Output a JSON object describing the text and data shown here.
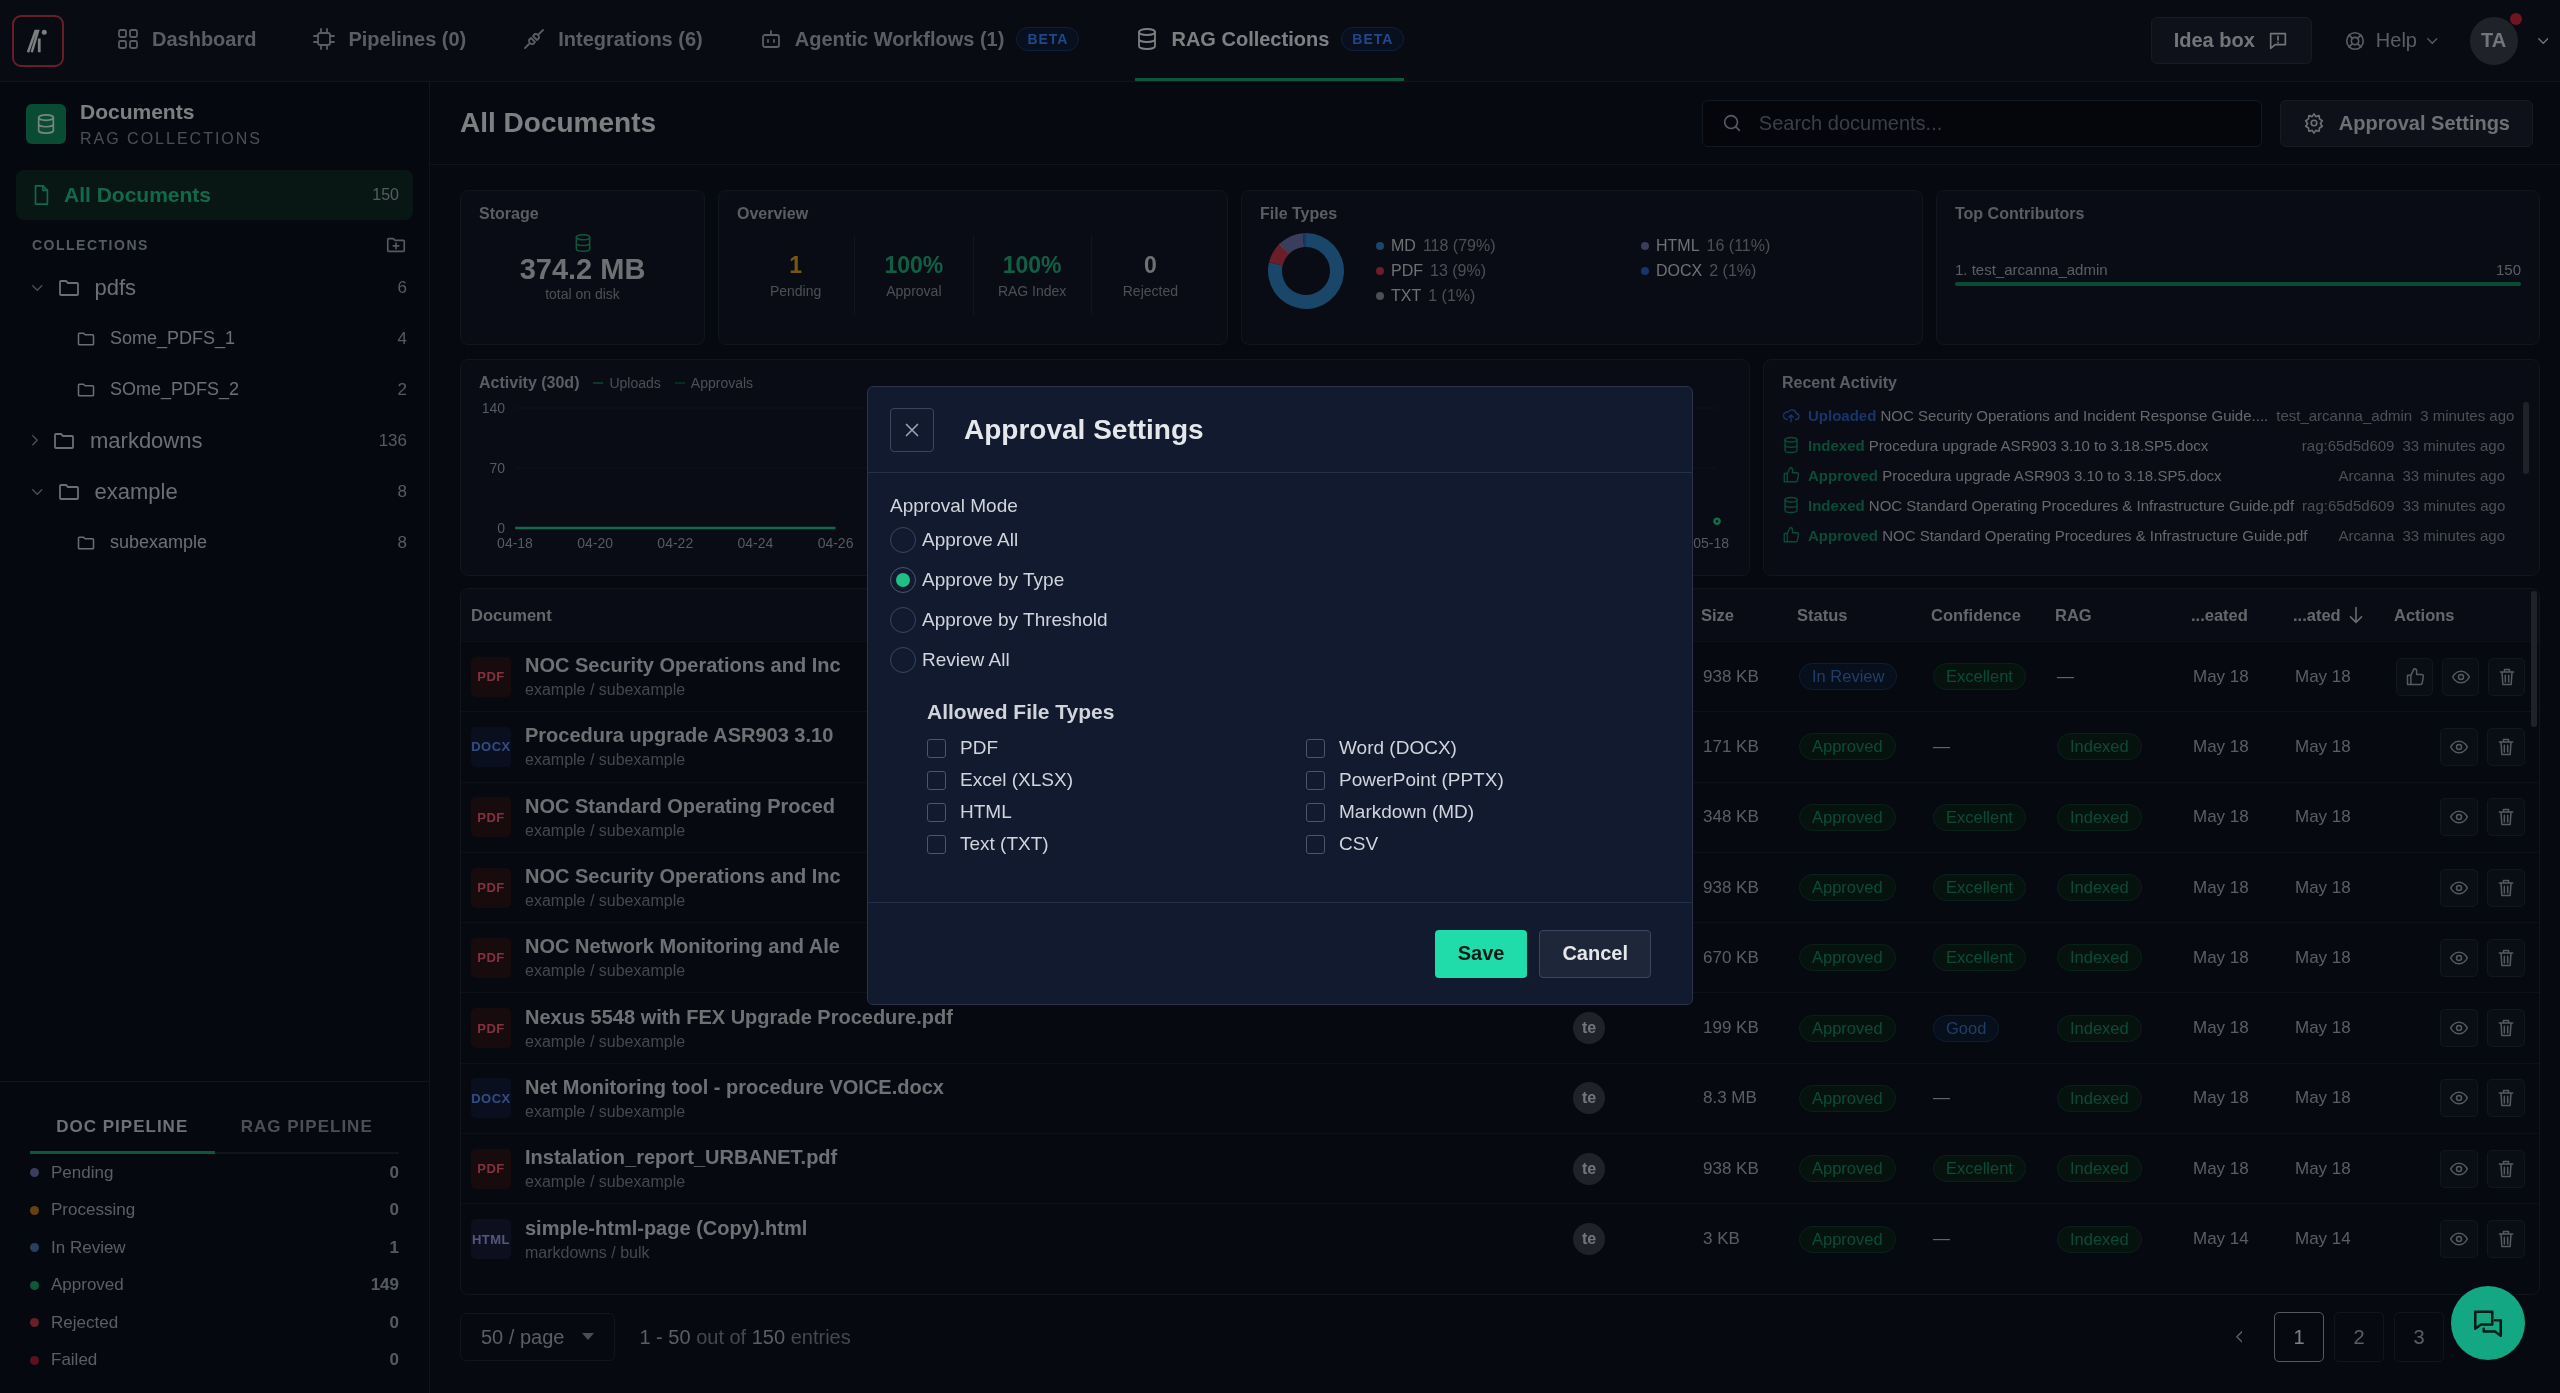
{
  "nav": {
    "tabs": [
      {
        "label": "Dashboard",
        "selected": false
      },
      {
        "label": "Pipelines (0)",
        "selected": false
      },
      {
        "label": "Integrations (6)",
        "selected": false
      },
      {
        "label": "Agentic Workflows (1)",
        "badge": "BETA",
        "selected": false
      },
      {
        "label": "RAG Collections",
        "badge": "BETA",
        "selected": true
      }
    ],
    "idea_box": "Idea box",
    "help": "Help",
    "avatar": "TA",
    "notification": true
  },
  "sidebar": {
    "title": "Documents",
    "subtitle": "RAG COLLECTIONS",
    "all_documents": {
      "label": "All Documents",
      "count": "150",
      "selected": true
    },
    "collections_label": "COLLECTIONS",
    "tree": [
      {
        "label": "pdfs",
        "count": "6",
        "expanded": true,
        "children": [
          {
            "label": "Some_PDFS_1",
            "count": "4"
          },
          {
            "label": "SOme_PDFS_2",
            "count": "2"
          }
        ]
      },
      {
        "label": "markdowns",
        "count": "136",
        "expanded": false
      },
      {
        "label": "example",
        "count": "8",
        "expanded": true,
        "children": [
          {
            "label": "subexample",
            "count": "8"
          }
        ]
      }
    ],
    "pipeline_tabs": [
      {
        "label": "DOC PIPELINE",
        "selected": true
      },
      {
        "label": "RAG PIPELINE",
        "selected": false
      }
    ],
    "pipeline_statuses": [
      {
        "label": "Pending",
        "count": "0",
        "color": "#3b3d5c"
      },
      {
        "label": "Processing",
        "count": "0",
        "color": "#654311"
      },
      {
        "label": "In Review",
        "count": "1",
        "color": "#293f61"
      },
      {
        "label": "Approved",
        "count": "149",
        "color": "#0c5a3a"
      },
      {
        "label": "Rejected",
        "count": "0",
        "color": "#6a1e29"
      },
      {
        "label": "Failed",
        "count": "0",
        "color": "#5a1220"
      }
    ]
  },
  "header": {
    "title": "All Documents",
    "search": {
      "placeholder": "Search documents..."
    },
    "settings_button": "Approval Settings"
  },
  "storage": {
    "title": "Storage",
    "value": "374.2 MB",
    "caption": "total on disk"
  },
  "overview": {
    "title": "Overview",
    "stats": [
      {
        "value": "1",
        "label": "Pending",
        "kind": "warning"
      },
      {
        "value": "100%",
        "label": "Approval",
        "kind": "success"
      },
      {
        "value": "100%",
        "label": "RAG Index",
        "kind": "success"
      },
      {
        "value": "0",
        "label": "Rejected",
        "kind": "neutral"
      }
    ]
  },
  "file_types": {
    "title": "File Types",
    "legend": [
      {
        "detail": "118 (79%)",
        "color": "#1a466a"
      },
      {
        "detail": "13 (9%)",
        "color": "#6a1e29"
      },
      {
        "detail": "1 (1%)",
        "color": "#4c4f54"
      },
      {
        "detail": "16 (11%)",
        "color": "#3b3d5c"
      },
      {
        "detail": "2 (1%)",
        "color": "#1a346a"
      }
    ],
    "chart_data": {
      "type": "donut",
      "categories": [
        "MD",
        "PDF",
        "TXT",
        "HTML",
        "DOCX"
      ],
      "values": [
        78.67,
        8.67,
        0.67,
        10.67,
        1.32
      ]
    }
  },
  "top_contributors": {
    "title": "Top Contributors",
    "items": [
      {
        "name": "1. test_arcanna_admin",
        "count": "150",
        "level": 1
      }
    ]
  },
  "activity": {
    "title": "Activity (30d)",
    "chart_data": {
      "type": "line",
      "ylim": [
        0,
        140
      ],
      "yticks": [
        0,
        70,
        140
      ],
      "categories": [
        "04-18",
        null,
        "04-20",
        null,
        "04-22",
        null,
        "04-24",
        null,
        "04-26",
        null,
        null,
        null,
        null,
        null,
        null,
        null,
        null,
        null,
        null,
        null,
        null,
        null,
        null,
        null,
        null,
        null,
        null,
        null,
        null,
        null,
        "05-18"
      ],
      "series": [
        {
          "name": "Uploads",
          "color": "#0f6a47",
          "values": [
            0,
            0,
            0,
            0,
            0,
            0,
            0,
            0,
            0,
            null,
            null,
            null,
            null,
            null,
            null,
            null,
            null,
            null,
            null,
            null,
            null,
            null,
            null,
            null,
            null,
            null,
            null,
            null,
            null,
            null,
            8
          ]
        },
        {
          "name": "Approvals",
          "color": "#0b5238",
          "values": [
            null,
            null,
            null,
            null,
            null,
            null,
            null,
            null,
            null,
            null,
            null,
            null,
            null,
            null,
            null,
            null,
            null,
            null,
            null,
            null,
            null,
            null,
            null,
            null,
            null,
            null,
            null,
            null,
            null,
            null,
            null
          ]
        }
      ]
    }
  },
  "recent_activity": {
    "title": "Recent Activity",
    "items": [
      {
        "kind": "uploaded",
        "action": "Uploaded",
        "file": "NOC Security Operations and Incident Response Guide....",
        "actor": "test_arcanna_admin",
        "time": "3 minutes ago"
      },
      {
        "kind": "indexed",
        "action": "Indexed",
        "file": "Procedura upgrade ASR903 3.10 to 3.18.SP5.docx",
        "actor": "rag:65d5d609",
        "time": "33 minutes ago"
      },
      {
        "kind": "approved",
        "action": "Approved",
        "file": "Procedura upgrade ASR903 3.10 to 3.18.SP5.docx",
        "actor": "Arcanna",
        "time": "33 minutes ago"
      },
      {
        "kind": "indexed",
        "action": "Indexed",
        "file": "NOC Standard Operating Procedures & Infrastructure Guide.pdf",
        "actor": "rag:65d5d609",
        "time": "33 minutes ago"
      },
      {
        "kind": "approved",
        "action": "Approved",
        "file": "NOC Standard Operating Procedures & Infrastructure Guide.pdf",
        "actor": "Arcanna",
        "time": "33 minutes ago"
      }
    ]
  },
  "table": {
    "columns": [
      {
        "label": "Document",
        "sorted": false
      },
      {
        "label": "Size",
        "sorted": false
      },
      {
        "label": "Status",
        "sorted": false
      },
      {
        "label": "Confidence",
        "sorted": false
      },
      {
        "label": "RAG",
        "sorted": false
      },
      {
        "label": "...eated",
        "sorted": false
      },
      {
        "label": "...ated",
        "sorted": true
      },
      {
        "label": "Actions",
        "sorted": false
      }
    ],
    "rows": [
      {
        "type": "PDF",
        "name": "NOC Security Operations and Inc",
        "path": "example / subexample",
        "size": "938 KB",
        "status": {
          "label": "In Review",
          "kind": "info"
        },
        "confidence": {
          "label": "Excellent",
          "kind": "success"
        },
        "rag": {
          "label": "—",
          "kind": "none"
        },
        "created": "May 18",
        "updated": "May 18",
        "can_approve": true
      },
      {
        "type": "DOCX",
        "name": "Procedura upgrade ASR903 3.10",
        "path": "example / subexample",
        "size": "171 KB",
        "status": {
          "label": "Approved",
          "kind": "success"
        },
        "confidence": {
          "label": "—",
          "kind": "none"
        },
        "rag": {
          "label": "Indexed",
          "kind": "success"
        },
        "created": "May 18",
        "updated": "May 18",
        "can_approve": false
      },
      {
        "type": "PDF",
        "name": "NOC Standard Operating Proced",
        "path": "example / subexample",
        "size": "348 KB",
        "status": {
          "label": "Approved",
          "kind": "success"
        },
        "confidence": {
          "label": "Excellent",
          "kind": "success"
        },
        "rag": {
          "label": "Indexed",
          "kind": "success"
        },
        "created": "May 18",
        "updated": "May 18",
        "can_approve": false
      },
      {
        "type": "PDF",
        "name": "NOC Security Operations and Inc",
        "path": "example / subexample",
        "size": "938 KB",
        "status": {
          "label": "Approved",
          "kind": "success"
        },
        "confidence": {
          "label": "Excellent",
          "kind": "success"
        },
        "rag": {
          "label": "Indexed",
          "kind": "success"
        },
        "created": "May 18",
        "updated": "May 18",
        "can_approve": false
      },
      {
        "type": "PDF",
        "name": "NOC Network Monitoring and Ale",
        "path": "example / subexample",
        "size": "670 KB",
        "status": {
          "label": "Approved",
          "kind": "success"
        },
        "confidence": {
          "label": "Excellent",
          "kind": "success"
        },
        "rag": {
          "label": "Indexed",
          "kind": "success"
        },
        "created": "May 18",
        "updated": "May 18",
        "can_approve": false
      },
      {
        "type": "PDF",
        "name": "Nexus 5548 with FEX Upgrade Procedure.pdf",
        "path": "example / subexample",
        "uploader": "te",
        "size": "199 KB",
        "status": {
          "label": "Approved",
          "kind": "success"
        },
        "confidence": {
          "label": "Good",
          "kind": "info"
        },
        "rag": {
          "label": "Indexed",
          "kind": "success"
        },
        "created": "May 18",
        "updated": "May 18",
        "can_approve": false
      },
      {
        "type": "DOCX",
        "name": "Net Monitoring tool - procedure VOICE.docx",
        "path": "example / subexample",
        "uploader": "te",
        "size": "8.3 MB",
        "status": {
          "label": "Approved",
          "kind": "success"
        },
        "confidence": {
          "label": "—",
          "kind": "none"
        },
        "rag": {
          "label": "Indexed",
          "kind": "success"
        },
        "created": "May 18",
        "updated": "May 18",
        "can_approve": false
      },
      {
        "type": "PDF",
        "name": "Instalation_report_URBANET.pdf",
        "path": "example / subexample",
        "uploader": "te",
        "size": "938 KB",
        "status": {
          "label": "Approved",
          "kind": "success"
        },
        "confidence": {
          "label": "Excellent",
          "kind": "success"
        },
        "rag": {
          "label": "Indexed",
          "kind": "success"
        },
        "created": "May 18",
        "updated": "May 18",
        "can_approve": false
      },
      {
        "type": "HTML",
        "name": "simple-html-page (Copy).html",
        "path": "markdowns / bulk",
        "uploader": "te",
        "size": "3 KB",
        "status": {
          "label": "Approved",
          "kind": "success"
        },
        "confidence": {
          "label": "—",
          "kind": "none"
        },
        "rag": {
          "label": "Indexed",
          "kind": "success"
        },
        "created": "May 14",
        "updated": "May 14",
        "can_approve": false
      }
    ]
  },
  "pagination": {
    "page_size": "50 / page",
    "summary": "**1 - 50** out of **150** entries",
    "pages": [
      {
        "label": "1",
        "selected": true
      },
      {
        "label": "2",
        "selected": false
      },
      {
        "label": "3",
        "selected": false
      }
    ]
  },
  "modal": {
    "title": "Approval Settings",
    "mode_label": "Approval Mode",
    "modes": [
      {
        "label": "Approve All",
        "selected": false
      },
      {
        "label": "Approve by Type",
        "selected": true
      },
      {
        "label": "Approve by Threshold",
        "selected": false
      },
      {
        "label": "Review All",
        "selected": false
      }
    ],
    "file_types_label": "Allowed File Types",
    "file_types": [
      {
        "label": "PDF",
        "checked": false
      },
      {
        "label": "Word (DOCX)",
        "checked": false
      },
      {
        "label": "Excel (XLSX)",
        "checked": false
      },
      {
        "label": "PowerPoint (PPTX)",
        "checked": false
      },
      {
        "label": "HTML",
        "checked": false
      },
      {
        "label": "Markdown (MD)",
        "checked": false
      },
      {
        "label": "Text (TXT)",
        "checked": false
      },
      {
        "label": "CSV",
        "checked": false
      }
    ],
    "buttons": [
      {
        "label": "Save",
        "kind": "primary"
      },
      {
        "label": "Cancel",
        "kind": "secondary"
      }
    ]
  }
}
